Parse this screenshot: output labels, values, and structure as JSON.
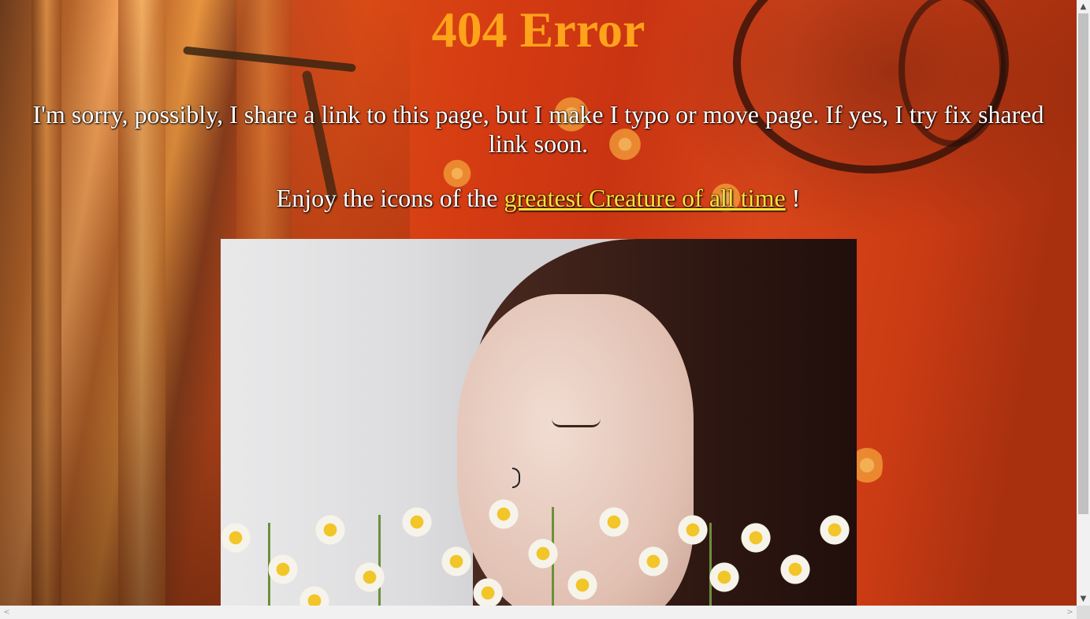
{
  "page": {
    "title": "404 Error",
    "message": "I'm sorry, possibly, I share a link to this page, but I make I typo or move page. If yes, I try fix shared link soon.",
    "enjoy_prefix": "Enjoy the icons of the ",
    "enjoy_link": "greatest Creature of all time",
    "enjoy_suffix": " !"
  },
  "colors": {
    "title": "#ffa31a",
    "link": "#ffe23a",
    "background": "#d63c12"
  },
  "icons": {
    "scroll_up": "▲",
    "scroll_down": "▼",
    "scroll_left": "<",
    "scroll_right": ">"
  }
}
